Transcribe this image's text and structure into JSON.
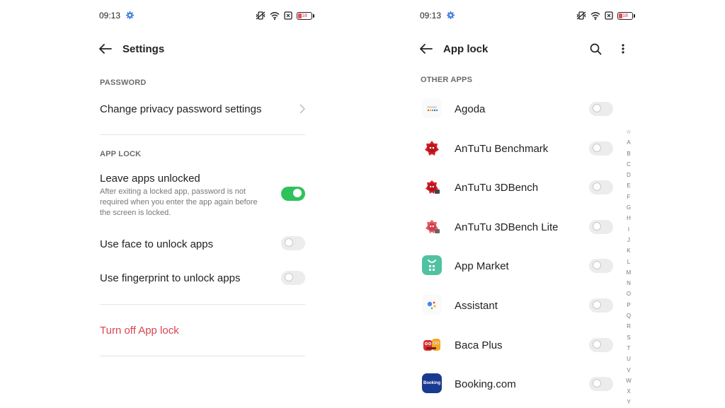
{
  "status_bar": {
    "time": "09:13",
    "battery_level": "18"
  },
  "left": {
    "title": "Settings",
    "password_section": "PASSWORD",
    "change_password": "Change privacy password settings",
    "app_lock_section": "APP LOCK",
    "leave_unlocked": {
      "label": "Leave apps unlocked",
      "description": "After exiting a locked app, password is not required when you enter the app again before the screen is locked.",
      "enabled": true
    },
    "face_unlock": {
      "label": "Use face to unlock apps",
      "enabled": false
    },
    "fingerprint_unlock": {
      "label": "Use fingerprint to unlock apps",
      "enabled": false
    },
    "turn_off": "Turn off App lock"
  },
  "right": {
    "title": "App lock",
    "section": "OTHER APPS",
    "apps": [
      {
        "name": "Agoda",
        "locked": false,
        "icon": "agoda-icon"
      },
      {
        "name": "AnTuTu Benchmark",
        "locked": false,
        "icon": "antutu-icon"
      },
      {
        "name": "AnTuTu 3DBench",
        "locked": false,
        "icon": "antutu-3dbench-icon"
      },
      {
        "name": "AnTuTu 3DBench Lite",
        "locked": false,
        "icon": "antutu-3dbench-lite-icon"
      },
      {
        "name": "App Market",
        "locked": false,
        "icon": "app-market-icon"
      },
      {
        "name": "Assistant",
        "locked": false,
        "icon": "assistant-icon"
      },
      {
        "name": "Baca Plus",
        "locked": false,
        "icon": "baca-plus-icon"
      },
      {
        "name": "Booking.com",
        "locked": false,
        "icon": "booking-icon"
      }
    ],
    "booking_icon_text": "Booking",
    "alphabet": [
      "☆",
      "A",
      "B",
      "C",
      "D",
      "E",
      "F",
      "G",
      "H",
      "I",
      "J",
      "K",
      "L",
      "M",
      "N",
      "O",
      "P",
      "Q",
      "R",
      "S",
      "T",
      "U",
      "V",
      "W",
      "X",
      "Y"
    ]
  },
  "colors": {
    "accent_green": "#2fc25b",
    "danger_red": "#d9454f",
    "gear_blue": "#3f7de0"
  }
}
